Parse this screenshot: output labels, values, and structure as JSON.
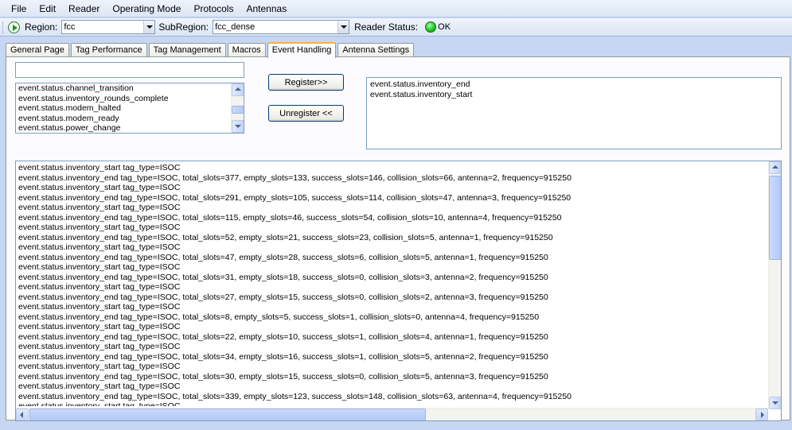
{
  "menubar": {
    "items": [
      "File",
      "Edit",
      "Reader",
      "Operating Mode",
      "Protocols",
      "Antennas"
    ]
  },
  "toolbar": {
    "region_label": "Region:",
    "region_value": "fcc",
    "subregion_label": "SubRegion:",
    "subregion_value": "fcc_dense",
    "reader_status_label": "Reader Status:",
    "reader_status_value": "OK",
    "status_color": "#19c219"
  },
  "tabs": [
    {
      "label": "General Page",
      "active": false
    },
    {
      "label": "Tag Performance",
      "active": false
    },
    {
      "label": "Tag Management",
      "active": false
    },
    {
      "label": "Macros",
      "active": false
    },
    {
      "label": "Event Handling",
      "active": true
    },
    {
      "label": "Antenna Settings",
      "active": false
    }
  ],
  "event_handling": {
    "filter_value": "",
    "available_events": [
      "event.status.channel_transition",
      "event.status.inventory_rounds_complete",
      "event.status.modem_halted",
      "event.status.modem_ready",
      "event.status.power_change"
    ],
    "register_label": "Register>>",
    "unregister_label": "Unregister <<",
    "registered_events": [
      "event.status.inventory_end",
      "event.status.inventory_start"
    ],
    "log_lines": [
      "event.status.inventory_start tag_type=ISOC",
      "event.status.inventory_end tag_type=ISOC, total_slots=377, empty_slots=133, success_slots=146, collision_slots=66, antenna=2, frequency=915250",
      "event.status.inventory_start tag_type=ISOC",
      "event.status.inventory_end tag_type=ISOC, total_slots=291, empty_slots=105, success_slots=114, collision_slots=47, antenna=3, frequency=915250",
      "event.status.inventory_start tag_type=ISOC",
      "event.status.inventory_end tag_type=ISOC, total_slots=115, empty_slots=46, success_slots=54, collision_slots=10, antenna=4, frequency=915250",
      "event.status.inventory_start tag_type=ISOC",
      "event.status.inventory_end tag_type=ISOC, total_slots=52, empty_slots=21, success_slots=23, collision_slots=5, antenna=1, frequency=915250",
      "event.status.inventory_start tag_type=ISOC",
      "event.status.inventory_end tag_type=ISOC, total_slots=47, empty_slots=28, success_slots=6, collision_slots=5, antenna=1, frequency=915250",
      "event.status.inventory_start tag_type=ISOC",
      "event.status.inventory_end tag_type=ISOC, total_slots=31, empty_slots=18, success_slots=0, collision_slots=3, antenna=2, frequency=915250",
      "event.status.inventory_start tag_type=ISOC",
      "event.status.inventory_end tag_type=ISOC, total_slots=27, empty_slots=15, success_slots=0, collision_slots=2, antenna=3, frequency=915250",
      "event.status.inventory_start tag_type=ISOC",
      "event.status.inventory_end tag_type=ISOC, total_slots=8, empty_slots=5, success_slots=1, collision_slots=0, antenna=4, frequency=915250",
      "event.status.inventory_start tag_type=ISOC",
      "event.status.inventory_end tag_type=ISOC, total_slots=22, empty_slots=10, success_slots=1, collision_slots=4, antenna=1, frequency=915250",
      "event.status.inventory_start tag_type=ISOC",
      "event.status.inventory_end tag_type=ISOC, total_slots=34, empty_slots=16, success_slots=1, collision_slots=5, antenna=2, frequency=915250",
      "event.status.inventory_start tag_type=ISOC",
      "event.status.inventory_end tag_type=ISOC, total_slots=30, empty_slots=15, success_slots=0, collision_slots=5, antenna=3, frequency=915250",
      "event.status.inventory_start tag_type=ISOC",
      "event.status.inventory_end tag_type=ISOC, total_slots=339, empty_slots=123, success_slots=148, collision_slots=63, antenna=4, frequency=915250",
      "event.status.inventory_start tag_type=ISOC"
    ]
  }
}
